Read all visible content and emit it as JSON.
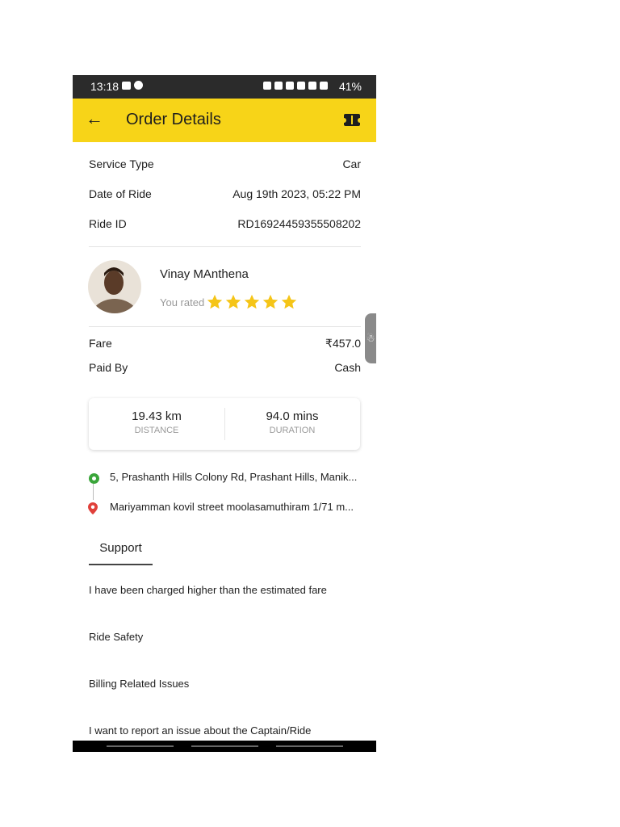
{
  "status_bar": {
    "time": "13:18",
    "battery": "41%"
  },
  "header": {
    "title": "Order Details",
    "back_icon": "back-arrow-icon",
    "ticket_icon": "ticket-icon"
  },
  "ride_info": [
    {
      "label": "Service Type",
      "value": "Car"
    },
    {
      "label": "Date of Ride",
      "value": "Aug 19th 2023, 05:22 PM"
    },
    {
      "label": "Ride ID",
      "value": "RD16924459355508202"
    }
  ],
  "captain": {
    "name": "Vinay MAnthena",
    "rated_label": "You rated",
    "rating": 5,
    "max_rating": 5
  },
  "payment": [
    {
      "label": "Fare",
      "value": "₹457.0"
    },
    {
      "label": "Paid By",
      "value": "Cash"
    }
  ],
  "stats": {
    "distance_value": "19.43 km",
    "distance_label": "DISTANCE",
    "duration_value": "94.0 mins",
    "duration_label": "DURATION"
  },
  "route": {
    "pickup": "5, Prashanth Hills Colony Rd, Prashant Hills, Manik...",
    "drop": "Mariyamman kovil street moolasamuthiram 1/71 m..."
  },
  "support": {
    "tab_label": "Support",
    "issues": [
      "I have been charged higher than the estimated fare",
      "Ride Safety",
      "Billing Related Issues",
      "I want to report an issue about the Captain/Ride"
    ]
  },
  "colors": {
    "header": "#f7d418",
    "star": "#f5c518",
    "status_bar": "#2b2b2b"
  }
}
